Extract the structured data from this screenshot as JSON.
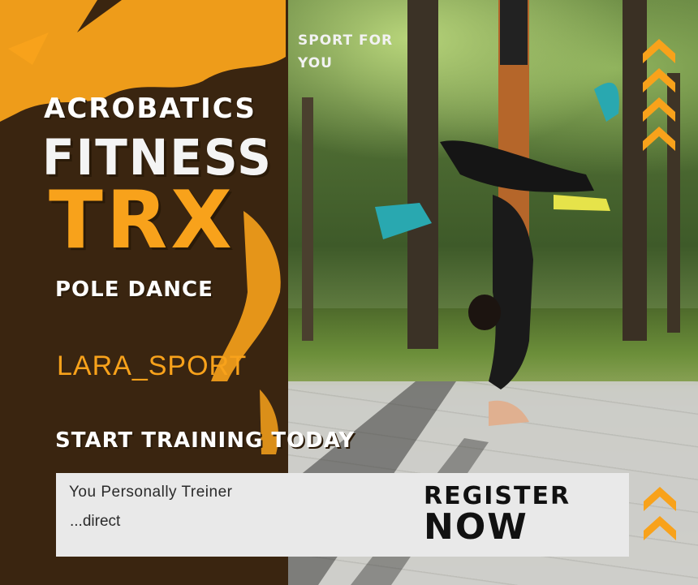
{
  "header": {
    "tagline": "SPORT FOR YOU"
  },
  "disciplines": {
    "acrobatics": "ACROBATICS",
    "fitness": "FITNESS",
    "trx": "TRX",
    "pole_dance": "POLE DANCE"
  },
  "brand": {
    "name": "LARA_SPORT"
  },
  "cta": {
    "headline": "START TRAINING TODAY",
    "trainer_line": "You Personally Treiner",
    "direct_line": "...direct",
    "register_label": "REGISTER",
    "now_label": "NOW"
  },
  "icons": {
    "decor_top_right": "chevron-up-icon",
    "decor_bottom_right": "chevron-up-icon"
  },
  "colors": {
    "accent": "#f8a21b",
    "panel": "#3a2510",
    "cta_box": "#e9e9e9"
  }
}
